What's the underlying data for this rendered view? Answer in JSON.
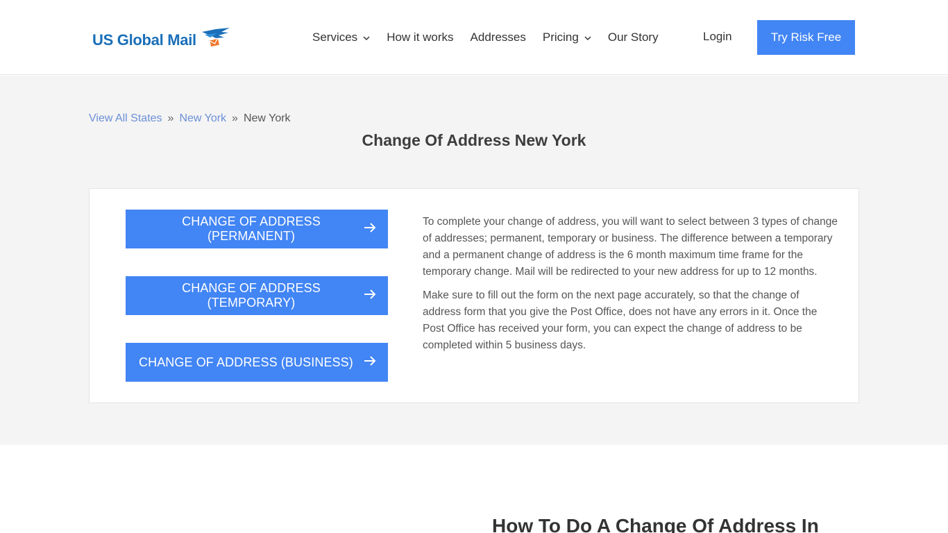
{
  "header": {
    "logo_text": "US Global Mail",
    "nav": {
      "services": "Services",
      "how_it_works": "How it works",
      "addresses": "Addresses",
      "pricing": "Pricing",
      "our_story": "Our Story"
    },
    "login": "Login",
    "cta": "Try Risk Free"
  },
  "breadcrumb": {
    "all_states": "View All States",
    "state": "New York",
    "current": "New York",
    "separator": "»"
  },
  "page_title": "Change Of Address New York",
  "options": [
    {
      "label": "CHANGE OF ADDRESS (PERMANENT)"
    },
    {
      "label": "CHANGE OF ADDRESS (TEMPORARY)"
    },
    {
      "label": "CHANGE OF ADDRESS (BUSINESS)"
    }
  ],
  "description": {
    "p1": "To complete your change of address, you will want to select between 3 types of change of addresses; permanent, temporary or business. The difference between a temporary and a permanent change of address is the 6 month maximum time frame for the temporary change. Mail will be redirected to your new address for up to 12 months.",
    "p2": "Make sure to fill out the form on the next page accurately, so that the change of address form that you give the Post Office, does not have any errors in it. Once the Post Office has received your form, you can expect the change of address to be completed within 5 business days."
  },
  "lower_heading": "How To Do A Change Of Address In",
  "colors": {
    "accent": "#4285f4",
    "logo_blue": "#1a6fb8",
    "logo_orange": "#f0782d",
    "link": "#6b8fd6",
    "section_bg": "#f4f4f4"
  }
}
